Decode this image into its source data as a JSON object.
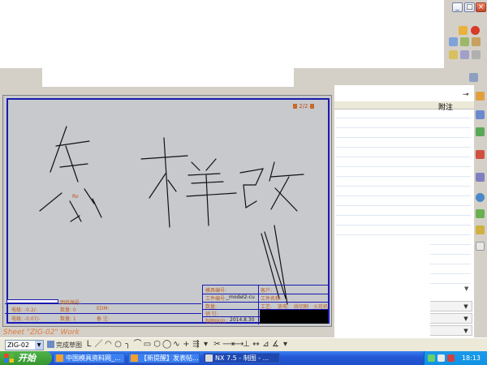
{
  "sheet": {
    "page_indicator": "2/2",
    "status_line": "Sheet \"ZIG-02\" Work",
    "selector_value": "ZIG-02",
    "sketch_label": "完成草图"
  },
  "handwriting": {
    "text": "怎样改"
  },
  "title_block": {
    "model_no_label": "模具编号:",
    "customer_label": "客户:",
    "drawing_label": "工件编号:",
    "drawing_value": "_model2-cu",
    "material_label": "工件名称:",
    "qty_label": "数量:",
    "process_label": "工艺:",
    "cut_label": "放电:",
    "wire_label": "线切割",
    "machine_label": "火花机",
    "pin_label": "销 钉:",
    "date_label": "制图时间:",
    "date_value": "2014.8.30",
    "row1_a": "电极: -0.2/-",
    "row1_b": "数量: 0",
    "row1_c": "EDM:",
    "row2_a": "电极: -0.07/-",
    "row2_b": "数量: 1",
    "row2_c": "备 注:",
    "bottom_label": "图纸编号:"
  },
  "side_panel": {
    "column_header": "附注"
  },
  "taskbar": {
    "start_label": "开始",
    "tasks": [
      "中国模具资料网_...",
      "【新提醒】发表帖...",
      "NX 7.5 - 制图 - ..."
    ],
    "clock": "18:13"
  },
  "colors": {
    "sheet_border": "#1a1ab0",
    "handwriting": "#111111",
    "canvas_bg": "#c7c9cc",
    "taskbar": "#245edb",
    "start_button": "#3c9a34"
  },
  "icons": [
    "minimize-icon",
    "maximize-icon",
    "close-icon",
    "pin-icon",
    "windows-flag-icon"
  ]
}
